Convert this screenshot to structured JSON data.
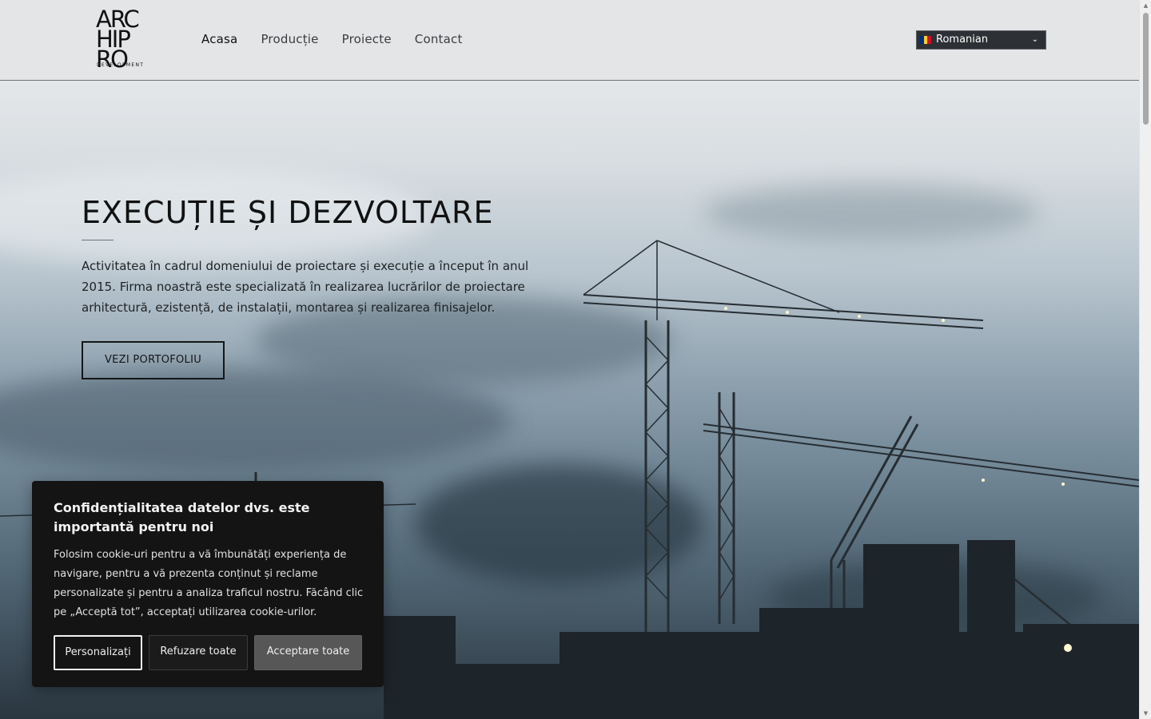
{
  "header": {
    "logo": {
      "lines": [
        "ARC",
        "HIP",
        "RO"
      ],
      "subtitle": "DEVELOPMENT"
    },
    "nav": [
      {
        "label": "Acasa",
        "active": true
      },
      {
        "label": "Producție",
        "active": false
      },
      {
        "label": "Proiecte",
        "active": false
      },
      {
        "label": "Contact",
        "active": false
      }
    ],
    "language": {
      "selected": "Romanian",
      "flag_colors": [
        "#002B7F",
        "#FCD116",
        "#CE1126"
      ]
    }
  },
  "hero": {
    "title": "EXECUȚIE ȘI DEZVOLTARE",
    "description": "Activitatea în cadrul domeniului de proiectare și execuție a început în anul 2015. Firma noastră este specializată în realizarea lucrărilor de proiectare arhitectură, ezistență, de instalații, montarea și realizarea finisajelor.",
    "button_label": "VEZI PORTOFOLIU"
  },
  "cookie_banner": {
    "title": "Confidențialitatea datelor dvs. este importantă pentru noi",
    "text": "Folosim cookie-uri pentru a vă îmbunătăți experiența de navigare, pentru a vă prezenta conținut și reclame personalizate și pentru a analiza traficul nostru. Făcând clic pe „Acceptă tot”, acceptați utilizarea cookie-urilor.",
    "buttons": {
      "customize": "Personalizați",
      "reject": "Refuzare toate",
      "accept": "Acceptare toate"
    }
  },
  "icons": {
    "language_dropdown": "chevron-down-icon",
    "scroll_up": "arrow-up-icon",
    "scroll_down": "arrow-down-icon"
  }
}
